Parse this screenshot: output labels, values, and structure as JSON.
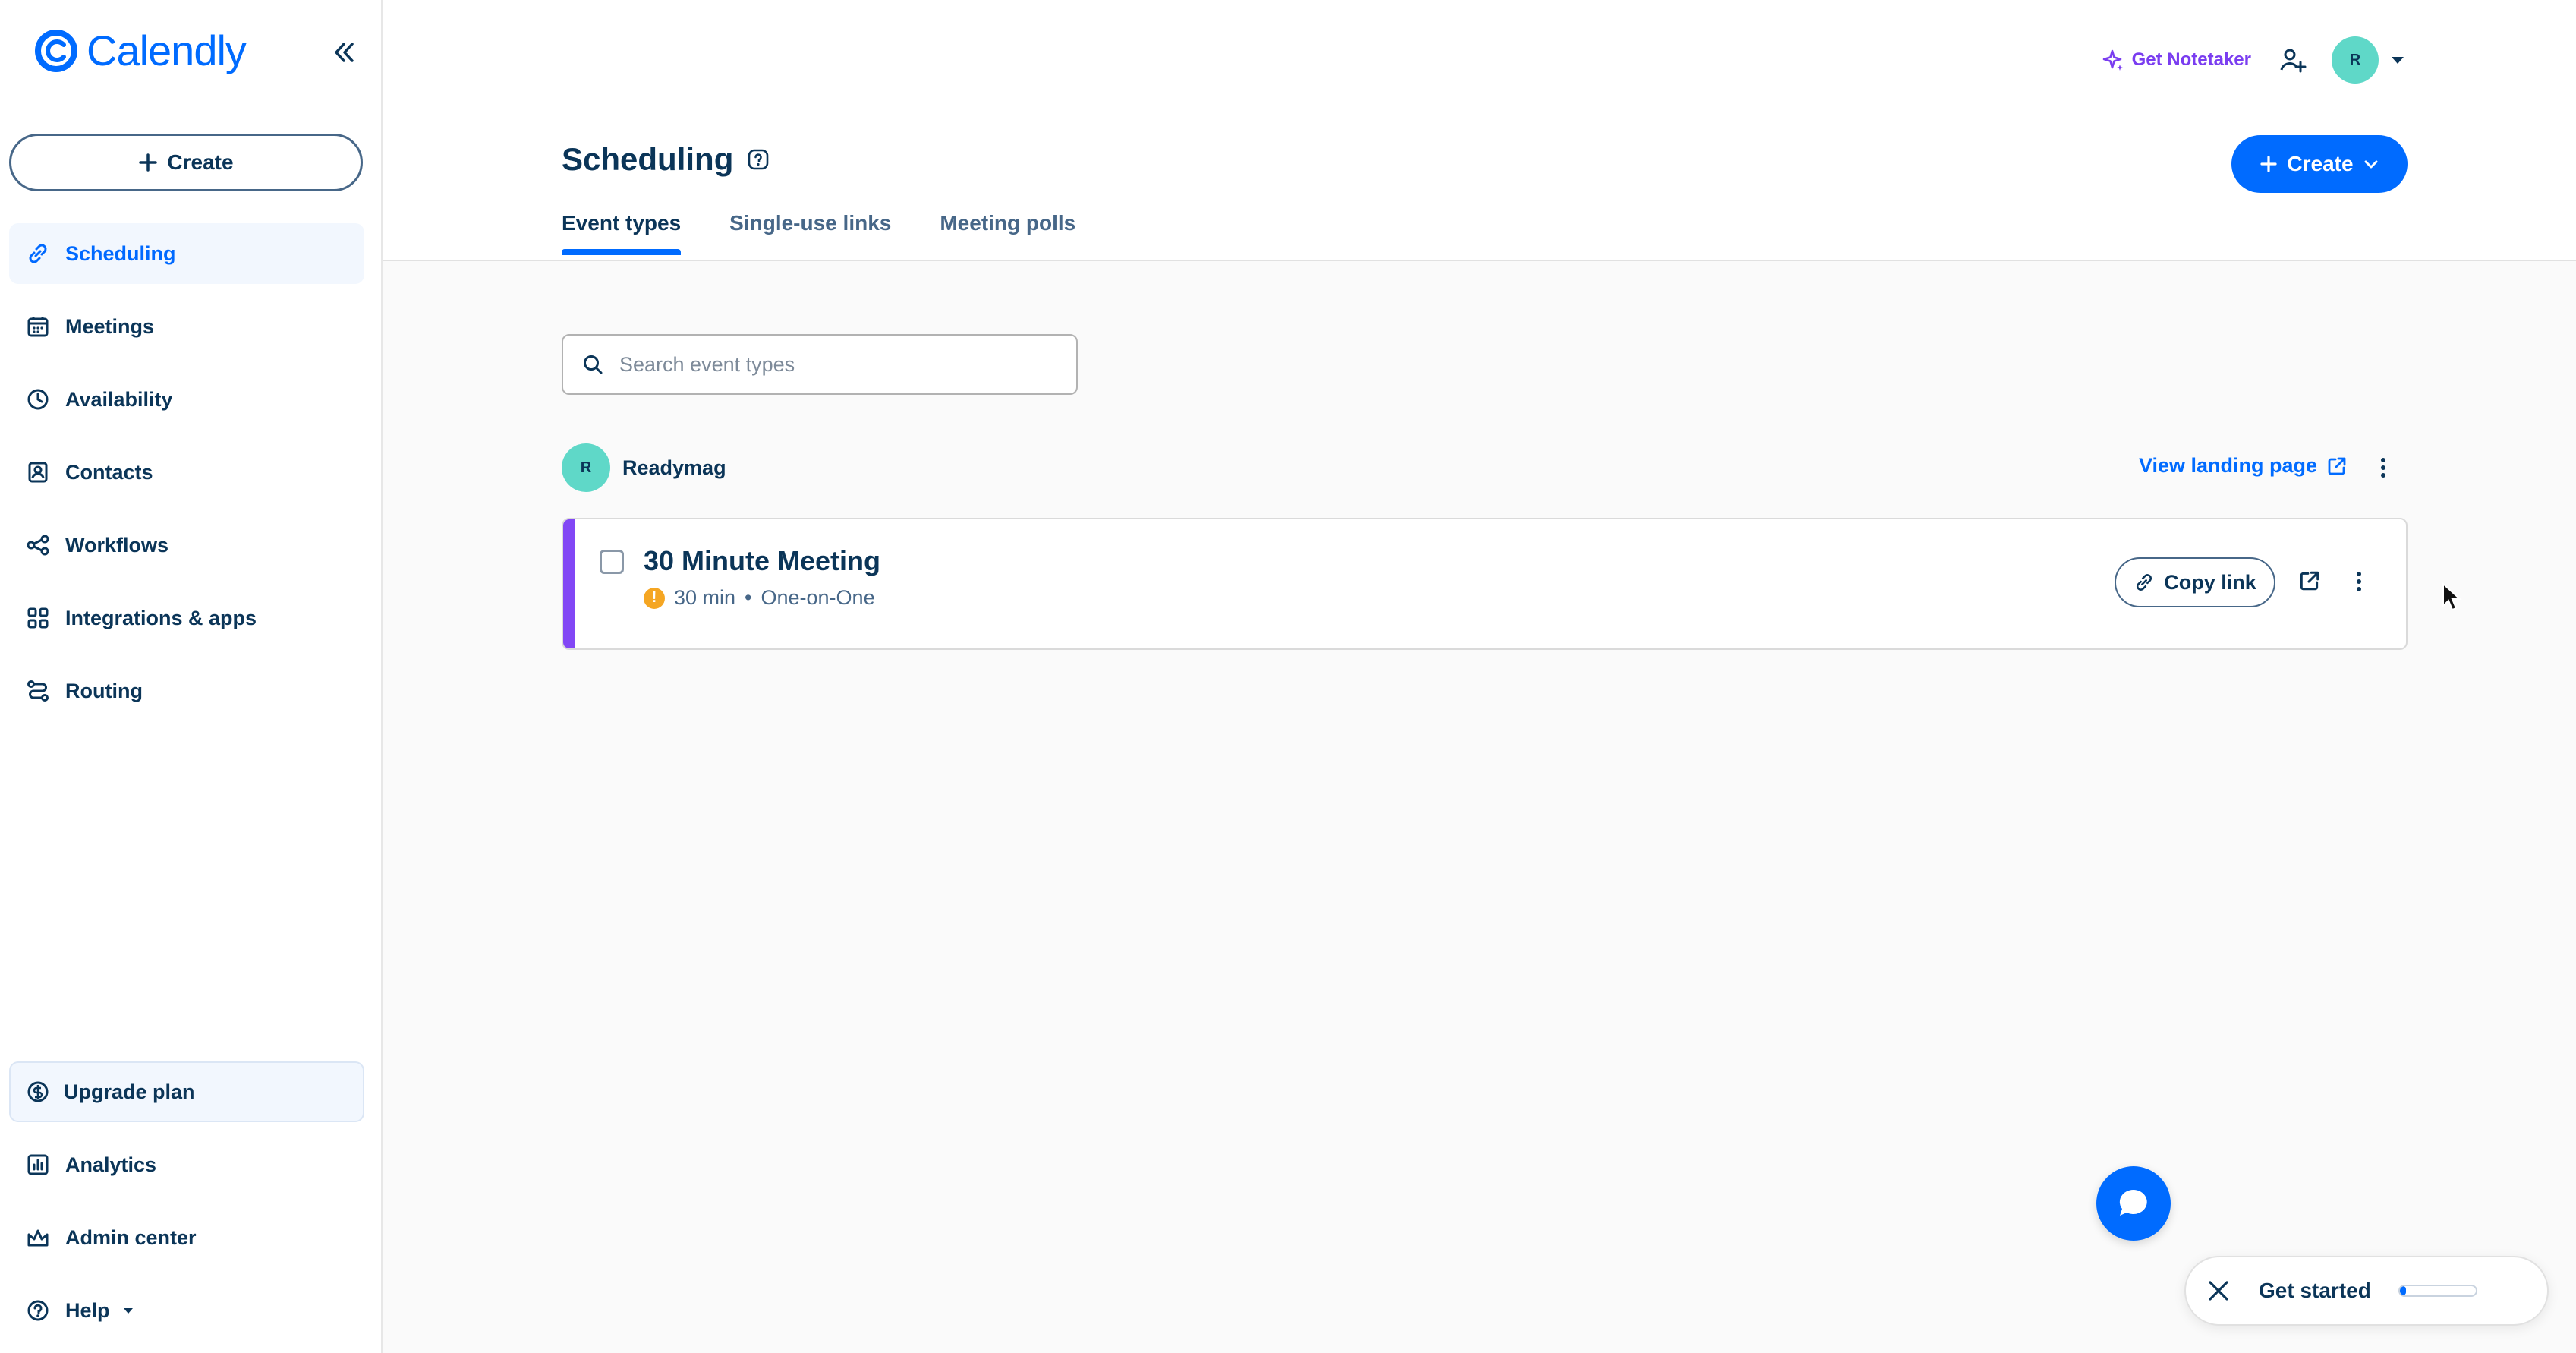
{
  "app": {
    "name": "Calendly"
  },
  "sidebar": {
    "create_label": "Create",
    "items": [
      {
        "label": "Scheduling",
        "icon": "link-icon",
        "active": true
      },
      {
        "label": "Meetings",
        "icon": "calendar-icon",
        "active": false
      },
      {
        "label": "Availability",
        "icon": "clock-icon",
        "active": false
      },
      {
        "label": "Contacts",
        "icon": "contact-icon",
        "active": false
      },
      {
        "label": "Workflows",
        "icon": "workflow-icon",
        "active": false
      },
      {
        "label": "Integrations & apps",
        "icon": "grid-icon",
        "active": false
      },
      {
        "label": "Routing",
        "icon": "routing-icon",
        "active": false
      }
    ],
    "upgrade_label": "Upgrade plan",
    "bottom_items": [
      {
        "label": "Analytics",
        "icon": "chart-icon"
      },
      {
        "label": "Admin center",
        "icon": "crown-icon"
      },
      {
        "label": "Help",
        "icon": "help-icon"
      }
    ]
  },
  "header": {
    "notetaker_label": "Get Notetaker",
    "avatar_initial": "R",
    "title": "Scheduling",
    "create_label": "Create",
    "tabs": [
      {
        "label": "Event types",
        "active": true
      },
      {
        "label": "Single-use links",
        "active": false
      },
      {
        "label": "Meeting polls",
        "active": false
      }
    ]
  },
  "search": {
    "placeholder": "Search event types"
  },
  "org": {
    "initial": "R",
    "name": "Readymag",
    "view_landing_label": "View landing page"
  },
  "event": {
    "title": "30 Minute Meeting",
    "duration": "30 min",
    "separator": "•",
    "type": "One-on-One",
    "copy_link_label": "Copy link",
    "color": "#8247f5"
  },
  "get_started": {
    "label": "Get started",
    "progress_percent": 8
  },
  "colors": {
    "accent": "#006bff",
    "text": "#0b3558",
    "muted": "#476788",
    "event_stripe": "#8247f5"
  }
}
